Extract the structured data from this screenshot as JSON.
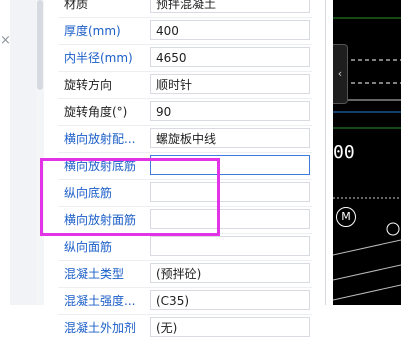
{
  "left_panel": {
    "close_glyph": "×"
  },
  "properties": [
    {
      "label": "材质",
      "value": "预拌混凝土",
      "blue": false
    },
    {
      "label": "厚度(mm)",
      "value": "400",
      "blue": true
    },
    {
      "label": "内半径(mm)",
      "value": "4650",
      "blue": true
    },
    {
      "label": "旋转方向",
      "value": "顺时针",
      "blue": false
    },
    {
      "label": "旋转角度(°)",
      "value": "90",
      "blue": false
    },
    {
      "label": "横向放射配...",
      "value": "螺旋板中线",
      "blue": true
    },
    {
      "label": "横向放射底筋",
      "value": "",
      "blue": true
    },
    {
      "label": "纵向底筋",
      "value": "",
      "blue": true
    },
    {
      "label": "横向放射面筋",
      "value": "",
      "blue": true
    },
    {
      "label": "纵向面筋",
      "value": "",
      "blue": true
    },
    {
      "label": "混凝土类型",
      "value": "(预拌砼)",
      "blue": true
    },
    {
      "label": "混凝土强度...",
      "value": "(C35)",
      "blue": true
    },
    {
      "label": "混凝土外加剂",
      "value": "(无)",
      "blue": true
    }
  ],
  "cad": {
    "tab_glyph": "‹",
    "text_fragment": "00",
    "marker_label": "M",
    "colors": {
      "background": "#000000",
      "foreground": "#ffffff"
    }
  },
  "accent_colors": {
    "link_label": "#1a5ec8",
    "highlight_box": "#e233e6",
    "focus_border": "#3d7be0"
  }
}
